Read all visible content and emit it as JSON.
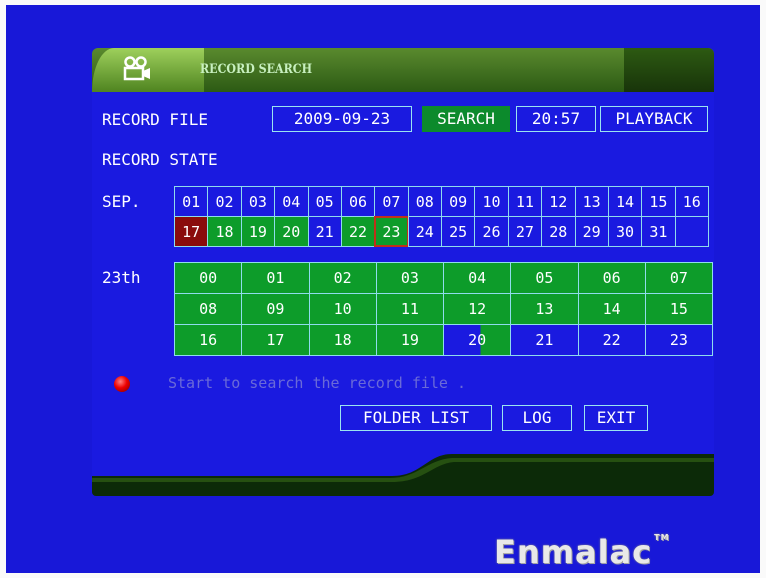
{
  "window": {
    "title": "RECORD SEARCH"
  },
  "record_file": {
    "label": "RECORD FILE",
    "date": "2009-09-23",
    "search_label": "SEARCH",
    "time": "20:57",
    "playback_label": "PLAYBACK"
  },
  "record_state": {
    "label": "RECORD STATE"
  },
  "calendar": {
    "month_label": "SEP.",
    "days": [
      {
        "label": "01",
        "state": "none"
      },
      {
        "label": "02",
        "state": "none"
      },
      {
        "label": "03",
        "state": "none"
      },
      {
        "label": "04",
        "state": "none"
      },
      {
        "label": "05",
        "state": "none"
      },
      {
        "label": "06",
        "state": "none"
      },
      {
        "label": "07",
        "state": "none"
      },
      {
        "label": "08",
        "state": "none"
      },
      {
        "label": "09",
        "state": "none"
      },
      {
        "label": "10",
        "state": "none"
      },
      {
        "label": "11",
        "state": "none"
      },
      {
        "label": "12",
        "state": "none"
      },
      {
        "label": "13",
        "state": "none"
      },
      {
        "label": "14",
        "state": "none"
      },
      {
        "label": "15",
        "state": "none"
      },
      {
        "label": "16",
        "state": "none"
      },
      {
        "label": "17",
        "state": "red"
      },
      {
        "label": "18",
        "state": "green"
      },
      {
        "label": "19",
        "state": "green"
      },
      {
        "label": "20",
        "state": "green"
      },
      {
        "label": "21",
        "state": "none"
      },
      {
        "label": "22",
        "state": "green"
      },
      {
        "label": "23",
        "state": "green-selected"
      },
      {
        "label": "24",
        "state": "none"
      },
      {
        "label": "25",
        "state": "none"
      },
      {
        "label": "26",
        "state": "none"
      },
      {
        "label": "27",
        "state": "none"
      },
      {
        "label": "28",
        "state": "none"
      },
      {
        "label": "29",
        "state": "none"
      },
      {
        "label": "30",
        "state": "none"
      },
      {
        "label": "31",
        "state": "none"
      },
      {
        "label": "",
        "state": "none"
      }
    ]
  },
  "hours": {
    "day_label": "23th",
    "cells": [
      {
        "label": "00",
        "state": "green"
      },
      {
        "label": "01",
        "state": "green"
      },
      {
        "label": "02",
        "state": "green"
      },
      {
        "label": "03",
        "state": "green"
      },
      {
        "label": "04",
        "state": "green"
      },
      {
        "label": "05",
        "state": "green"
      },
      {
        "label": "06",
        "state": "green"
      },
      {
        "label": "07",
        "state": "green"
      },
      {
        "label": "08",
        "state": "green"
      },
      {
        "label": "09",
        "state": "green"
      },
      {
        "label": "10",
        "state": "green"
      },
      {
        "label": "11",
        "state": "green"
      },
      {
        "label": "12",
        "state": "green"
      },
      {
        "label": "13",
        "state": "green"
      },
      {
        "label": "14",
        "state": "green"
      },
      {
        "label": "15",
        "state": "green"
      },
      {
        "label": "16",
        "state": "green"
      },
      {
        "label": "17",
        "state": "green"
      },
      {
        "label": "18",
        "state": "green"
      },
      {
        "label": "19",
        "state": "green"
      },
      {
        "label": "20",
        "state": "half"
      },
      {
        "label": "21",
        "state": "none"
      },
      {
        "label": "22",
        "state": "none"
      },
      {
        "label": "23",
        "state": "none"
      }
    ]
  },
  "status": {
    "message": "Start to search the record file ."
  },
  "buttons": {
    "folder_list": "FOLDER LIST",
    "log": "LOG",
    "exit": "EXIT"
  },
  "brand": {
    "name": "Enmalac",
    "tm": "TM"
  },
  "colors": {
    "screen_blue": "#1818d8",
    "cell_green": "#0d9c2a",
    "cell_red": "#8a0c0c",
    "grid_line": "#8fdcec",
    "status_text": "#6a6ad8"
  }
}
